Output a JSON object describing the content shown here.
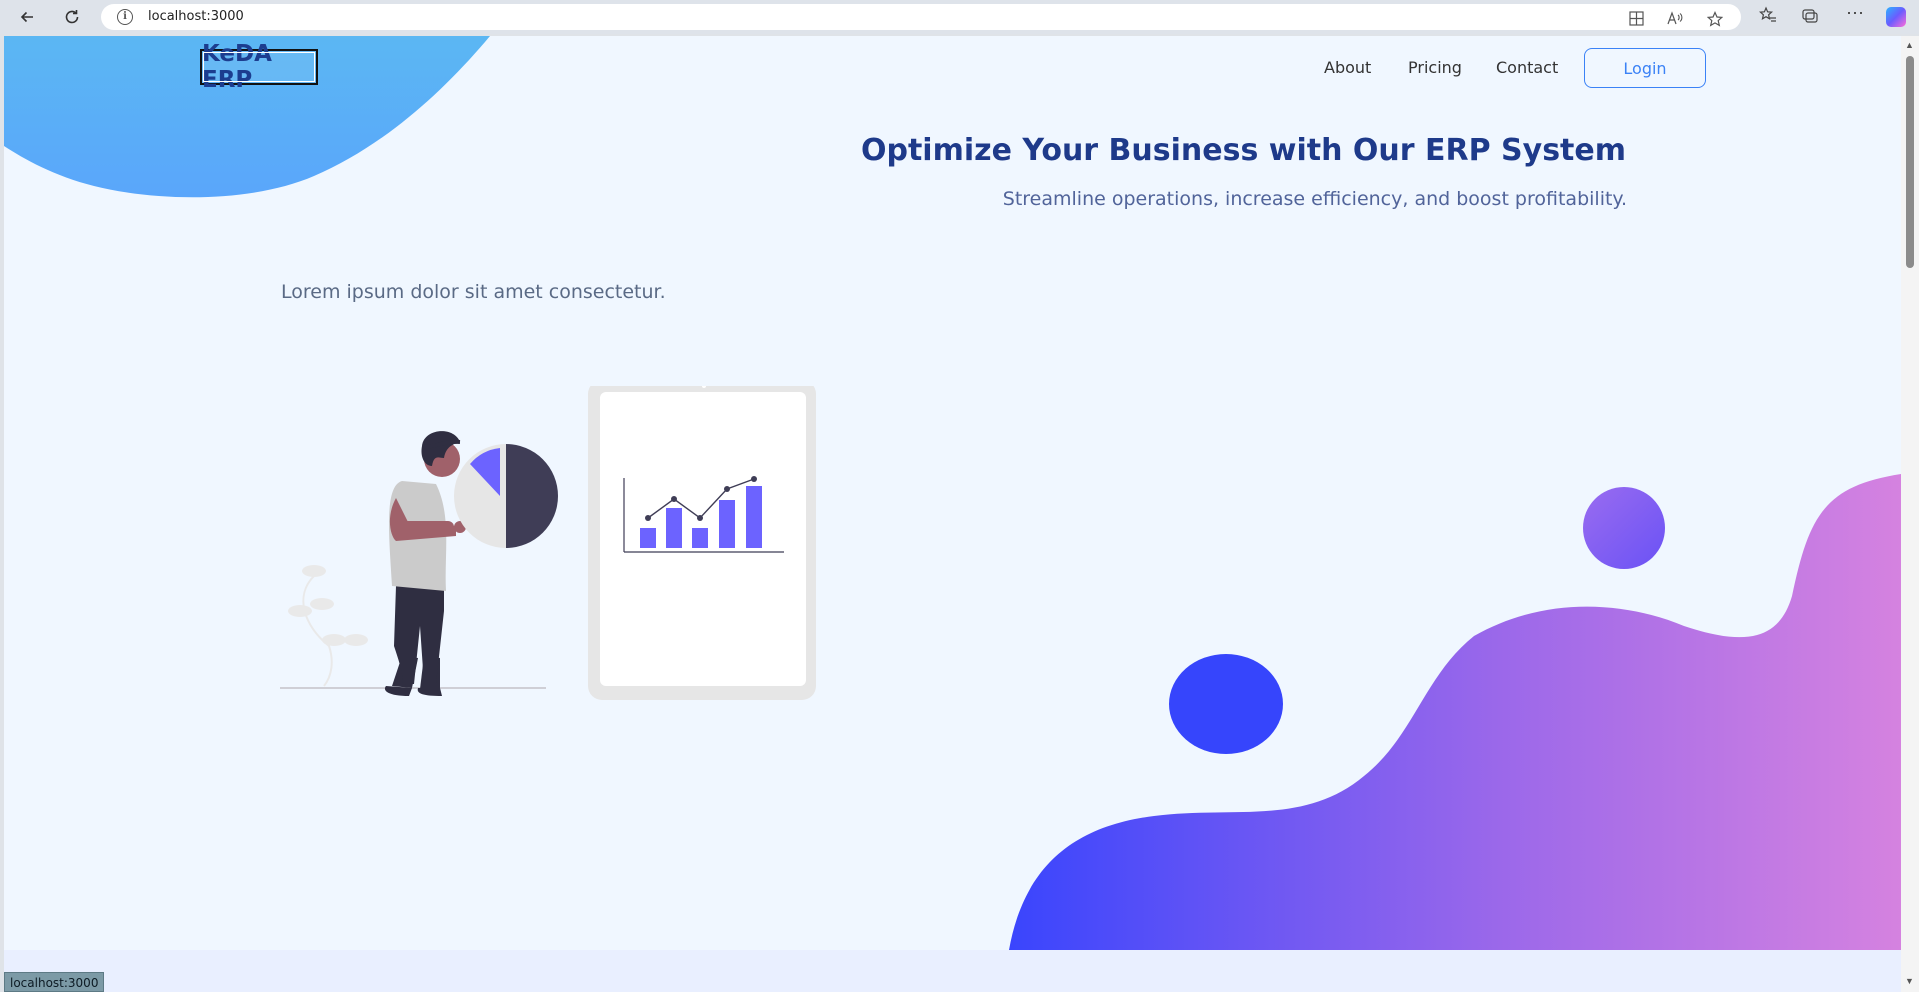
{
  "browser": {
    "url": "localhost:3000",
    "status_text": "localhost:3000"
  },
  "header": {
    "logo": "KeDA ERP",
    "nav": [
      "About",
      "Pricing",
      "Contact"
    ],
    "login_label": "Login"
  },
  "hero": {
    "title": "Optimize Your Business with Our ERP System",
    "subtitle": "Streamline operations, increase efficiency, and boost profitability.",
    "lorem": "Lorem ipsum dolor sit amet consectetur."
  },
  "colors": {
    "page_bg": "#f0f7ff",
    "brand_navy": "#1e3a8a",
    "accent_blue": "#3b82f6",
    "chart_purple": "#6c63ff",
    "wave_start": "#3b46ff",
    "wave_end": "#d47fe1"
  }
}
